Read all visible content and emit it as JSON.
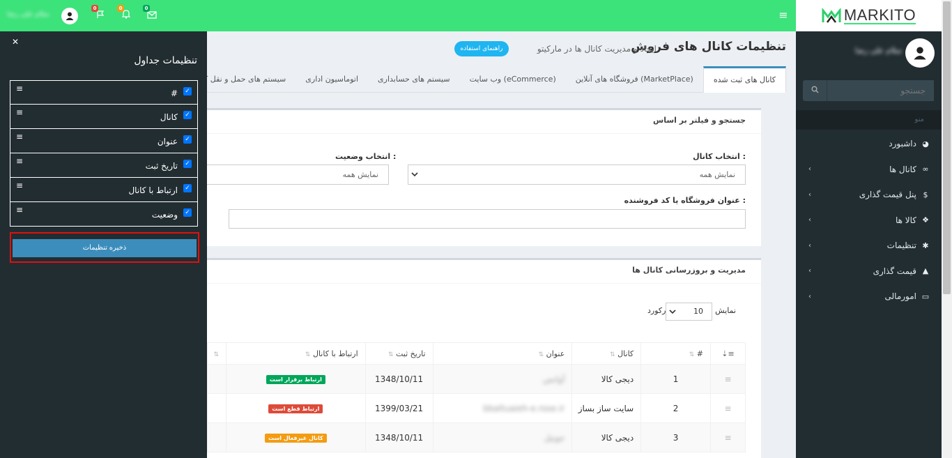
{
  "brand": {
    "logo_text": "MARKITO"
  },
  "topbar": {
    "user_name": "سلام علی رضا",
    "badges": {
      "messages": "0",
      "notifications": "0",
      "flags": "0"
    }
  },
  "sidebar": {
    "user_name": "سلام علی رضا",
    "search_placeholder": "جستجو",
    "menu_header": "منو",
    "items": [
      {
        "label": "داشبورد",
        "icon": "dashboard-icon",
        "has_children": false
      },
      {
        "label": "کانال ها",
        "icon": "link-icon",
        "has_children": true
      },
      {
        "label": "پنل قیمت گذاری",
        "icon": "dollar-icon",
        "has_children": true
      },
      {
        "label": "کالا ها",
        "icon": "cubes-icon",
        "has_children": true
      },
      {
        "label": "تنظیمات",
        "icon": "gear-icon",
        "has_children": true
      },
      {
        "label": "قیمت گذاری",
        "icon": "area-chart-icon",
        "has_children": true
      },
      {
        "label": "امورمالی",
        "icon": "credit-card-icon",
        "has_children": true
      }
    ]
  },
  "page": {
    "title": "تنظیمات کانال های فروش",
    "subtitle": "ایجاد و مدیریت کانال ها در مارکیتو",
    "help_button": "راهنمای استفاده",
    "tabs": [
      "کانال های ثبت شده",
      "فروشگاه های آنلاین (MarketPlace)",
      "وب سایت (eCommerce)",
      "سیستم های حسابداری",
      "اتوماسیون اداری",
      "سیستم های حمل و نقل کالا"
    ]
  },
  "filter": {
    "title": "جستجو و فیلتر بر اساس",
    "channel_label": "انتخاب کانال :",
    "channel_value": "نمایش همه",
    "status_label": "انتخاب وضعیت :",
    "status_value": "نمایش همه",
    "store_label": "عنوان فروشگاه یا کد فروشنده :",
    "store_value": ""
  },
  "manage": {
    "title": "مدیریت و بروزرسانی کانال ها",
    "show_label": "نمایش",
    "page_size": "10",
    "records_label": "رکورد",
    "columns": [
      "#",
      "کانال",
      "عنوان",
      "تاریخ ثبت",
      "ارتباط با کانال"
    ],
    "rows": [
      {
        "num": "1",
        "channel": "دیجی کالا",
        "title": "آوانس",
        "date": "1348/10/11",
        "status": "ارتباط برقرار است",
        "status_color": "#00a65a"
      },
      {
        "num": "2",
        "channel": "سایت ساز بساز",
        "title": "bbaltuaieh-e.rose.ir",
        "date": "1399/03/21",
        "status": "ارتباط قطع است",
        "status_color": "#dd4b39"
      },
      {
        "num": "3",
        "channel": "دیجی کالا",
        "title": "جوتیل",
        "date": "1348/10/11",
        "status": "کانال غیرفعال است",
        "status_color": "#f39c12"
      }
    ]
  },
  "settings_panel": {
    "title": "تنظیمات جداول",
    "columns": [
      {
        "label": "#",
        "checked": true
      },
      {
        "label": "کانال",
        "checked": true
      },
      {
        "label": "عنوان",
        "checked": true
      },
      {
        "label": "تاریخ ثبت",
        "checked": true
      },
      {
        "label": "ارتباط با کانال",
        "checked": true
      },
      {
        "label": "وضعیت",
        "checked": true
      }
    ],
    "save_button": "ذخیره تنظیمات"
  },
  "colors": {
    "topbar": "#3ce27a",
    "sidebar": "#222d32",
    "primary": "#3c8dbc",
    "help": "#1fb5f0"
  }
}
